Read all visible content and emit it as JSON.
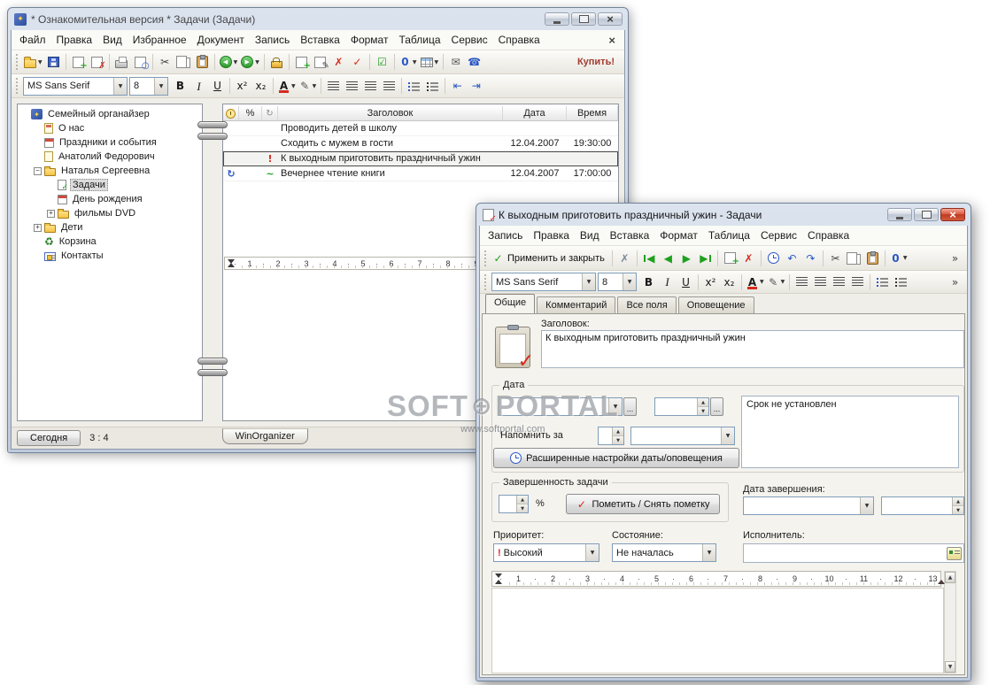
{
  "colors": {
    "accent_green": "#1fa11f",
    "accent_red": "#d42a1e",
    "accent_blue": "#2a57c6",
    "buy_link": "#a23c2f"
  },
  "watermark": {
    "left": "SOFT",
    "globe": "⊕",
    "right": "PORTAL",
    "url": "www.softportal.com"
  },
  "main_window": {
    "title": "* Ознакомительная версия * Задачи (Задачи)",
    "menu": [
      "Файл",
      "Правка",
      "Вид",
      "Избранное",
      "Документ",
      "Запись",
      "Вставка",
      "Формат",
      "Таблица",
      "Сервис",
      "Справка"
    ],
    "buy_label": "Купить!",
    "toolbar_icons": [
      {
        "name": "open-file",
        "shape": "folder",
        "dropdown": true
      },
      {
        "name": "save",
        "shape": "disk"
      },
      {
        "sep": true
      },
      {
        "name": "new-note",
        "shape": "page",
        "glyph": "+",
        "color": "#1fa11f"
      },
      {
        "name": "delete-note",
        "shape": "page",
        "glyph": "✗",
        "color": "#d42a1e"
      },
      {
        "sep": true
      },
      {
        "name": "print",
        "shape": "printer"
      },
      {
        "name": "print-preview",
        "shape": "page",
        "glyph": "○",
        "color": "#2a57c6"
      },
      {
        "sep": true
      },
      {
        "name": "cut",
        "glyph": "✂",
        "color": "#444444"
      },
      {
        "name": "copy",
        "shape": "pages"
      },
      {
        "name": "paste",
        "shape": "clip"
      },
      {
        "sep": true
      },
      {
        "name": "nav-back",
        "shape": "circle",
        "glyph": "◀",
        "dropdown": true
      },
      {
        "name": "nav-forward",
        "shape": "circle",
        "glyph": "▶",
        "dropdown": true
      },
      {
        "sep": true
      },
      {
        "name": "protect",
        "shape": "lock"
      },
      {
        "sep": true
      },
      {
        "name": "add-record",
        "shape": "page",
        "glyph": "+",
        "color": "#1fa11f"
      },
      {
        "name": "edit-record",
        "shape": "page",
        "glyph": "✎",
        "color": "#555555"
      },
      {
        "name": "delete-record",
        "glyph": "✗",
        "color": "#d42a1e"
      },
      {
        "name": "mark-record",
        "glyph": "✓",
        "color": "#d42a1e"
      },
      {
        "sep": true
      },
      {
        "name": "checkbox-field",
        "glyph": "☑",
        "color": "#1fa11f"
      },
      {
        "sep": true
      },
      {
        "name": "attachments",
        "glyph": "0",
        "color": "#2a57c6",
        "cls": "tb-bold",
        "dropdown": true
      },
      {
        "name": "insert-table",
        "shape": "grid",
        "dropdown": true
      },
      {
        "sep": true
      },
      {
        "name": "send-mail",
        "glyph": "✉",
        "color": "#555555"
      },
      {
        "name": "contact-call",
        "glyph": "☎",
        "color": "#2a57c6"
      }
    ],
    "format_bar": {
      "font": "MS Sans Serif",
      "size": "8"
    },
    "format_icons": [
      {
        "name": "bold",
        "glyph": "B",
        "cls": "tb-bold"
      },
      {
        "name": "italic",
        "glyph": "I",
        "cls": "tb-italic"
      },
      {
        "name": "underline",
        "glyph": "U",
        "cls": "tb-under"
      },
      {
        "sep": true
      },
      {
        "name": "superscript",
        "glyph": "x²"
      },
      {
        "name": "subscript",
        "glyph": "x₂"
      },
      {
        "sep": true
      },
      {
        "name": "font-color",
        "glyph": "A",
        "cls": "tb-bold a-color",
        "dropdown": true
      },
      {
        "name": "highlight",
        "glyph": "✎",
        "color": "#555555",
        "dropdown": true
      },
      {
        "sep": true
      },
      {
        "name": "align-left",
        "shape": "align"
      },
      {
        "name": "align-center",
        "shape": "align"
      },
      {
        "name": "align-right",
        "shape": "align"
      },
      {
        "name": "align-justify",
        "shape": "align"
      },
      {
        "sep": true
      },
      {
        "name": "bullet-list",
        "shape": "bullets"
      },
      {
        "name": "numbered-list",
        "shape": "bullets",
        "cls2": "num"
      },
      {
        "sep": true
      },
      {
        "name": "decrease-indent",
        "glyph": "⇤",
        "color": "#2a57c6"
      },
      {
        "name": "increase-indent",
        "glyph": "⇥",
        "color": "#2a57c6"
      }
    ],
    "tree": {
      "items": [
        {
          "label": "Семейный органайзер",
          "level": 0,
          "icon": "org",
          "expander": null
        },
        {
          "label": "О нас",
          "level": 1,
          "icon": "note-red",
          "expander": null
        },
        {
          "label": "Праздники и события",
          "level": 1,
          "icon": "cal",
          "expander": null
        },
        {
          "label": "Анатолий Федорович",
          "level": 1,
          "icon": "note",
          "expander": null
        },
        {
          "label": "Наталья Сергеевна",
          "level": 1,
          "icon": "folder",
          "expander": "minus"
        },
        {
          "label": "Задачи",
          "level": 2,
          "icon": "check",
          "expander": null,
          "selected": true
        },
        {
          "label": "День рождения",
          "level": 2,
          "icon": "cal",
          "expander": null
        },
        {
          "label": "фильмы DVD",
          "level": 2,
          "icon": "folder",
          "expander": "plus"
        },
        {
          "label": "Дети",
          "level": 1,
          "icon": "folder",
          "expander": "plus"
        },
        {
          "label": "Корзина",
          "level": 1,
          "icon": "recycle",
          "expander": null
        },
        {
          "label": "Контакты",
          "level": 1,
          "icon": "contacts",
          "expander": null
        }
      ]
    },
    "task_table": {
      "columns": [
        {
          "icon": "alarm"
        },
        {
          "label": "%"
        },
        {
          "icon": "recur"
        },
        {
          "label": "Заголовок"
        },
        {
          "label": "Дата"
        },
        {
          "label": "Время"
        }
      ],
      "rows": [
        {
          "title": "Проводить детей в школу",
          "date": "",
          "time": ""
        },
        {
          "title": "Сходить с мужем в гости",
          "date": "12.04.2007",
          "time": "19:30:00"
        },
        {
          "title": "К выходным приготовить праздничный ужин",
          "date": "",
          "time": "",
          "flag": "priority",
          "selected": true
        },
        {
          "title": "Вечернее чтение книги",
          "date": "12.04.2007",
          "time": "17:00:00",
          "alarm": "recur",
          "flag": "tilde"
        }
      ]
    },
    "ruler_numbers": [
      "1",
      "2",
      "3",
      "4",
      "5",
      "6",
      "7",
      "8",
      "9"
    ],
    "status": {
      "today_button": "Сегодня",
      "counter": "3 : 4",
      "notebook_tab": "WinOrganizer"
    }
  },
  "dialog": {
    "title": "К выходным приготовить праздничный ужин - Задачи",
    "menu": [
      "Запись",
      "Правка",
      "Вид",
      "Вставка",
      "Формат",
      "Таблица",
      "Сервис",
      "Справка"
    ],
    "toolbar_icons": [
      {
        "name": "apply-and-close",
        "glyph": "✓",
        "color": "#1fa11f",
        "cls": "tb-bold",
        "label": "Применить и закрыть"
      },
      {
        "sep": true
      },
      {
        "name": "cancel",
        "glyph": "✗",
        "color": "#7a8798"
      },
      {
        "sep": true
      },
      {
        "name": "first-record",
        "glyph": "◀",
        "color": "#1fa11f",
        "cls": "bar-l"
      },
      {
        "name": "prev-record",
        "glyph": "◀",
        "color": "#1fa11f"
      },
      {
        "name": "next-record",
        "glyph": "▶",
        "color": "#1fa11f"
      },
      {
        "name": "last-record",
        "glyph": "▶",
        "color": "#1fa11f",
        "cls": "bar-r"
      },
      {
        "sep": true
      },
      {
        "name": "add-record",
        "shape": "page",
        "glyph": "+",
        "color": "#1fa11f"
      },
      {
        "name": "delete-record",
        "glyph": "✗",
        "color": "#d42a1e"
      },
      {
        "sep": true
      },
      {
        "name": "alarm",
        "shape": "clock"
      },
      {
        "name": "undo",
        "glyph": "↶",
        "color": "#2a57c6"
      },
      {
        "name": "redo",
        "glyph": "↷",
        "color": "#2a57c6"
      },
      {
        "sep": true
      },
      {
        "name": "cut",
        "glyph": "✂",
        "color": "#444444"
      },
      {
        "name": "copy",
        "shape": "pages"
      },
      {
        "name": "paste",
        "shape": "clip"
      },
      {
        "sep": true
      },
      {
        "name": "attachments",
        "glyph": "0",
        "color": "#2a57c6",
        "cls": "tb-bold",
        "dropdown": true
      },
      {
        "name": "toolbar-overflow",
        "glyph": "»",
        "color": "#444444",
        "right": true
      }
    ],
    "format_bar": {
      "font": "MS Sans Serif",
      "size": "8"
    },
    "format_icons": [
      {
        "name": "bold",
        "glyph": "B",
        "cls": "tb-bold"
      },
      {
        "name": "italic",
        "glyph": "I",
        "cls": "tb-italic"
      },
      {
        "name": "underline",
        "glyph": "U",
        "cls": "tb-under"
      },
      {
        "sep": true
      },
      {
        "name": "superscript",
        "glyph": "x²"
      },
      {
        "name": "subscript",
        "glyph": "x₂"
      },
      {
        "sep": true
      },
      {
        "name": "font-color",
        "glyph": "A",
        "cls": "tb-bold a-color",
        "dropdown": true
      },
      {
        "name": "highlight",
        "glyph": "✎",
        "color": "#555555",
        "dropdown": true
      },
      {
        "sep": true
      },
      {
        "name": "align-left",
        "shape": "align"
      },
      {
        "name": "align-center",
        "shape": "align"
      },
      {
        "name": "align-right",
        "shape": "align"
      },
      {
        "name": "align-justify",
        "shape": "align"
      },
      {
        "sep": true
      },
      {
        "name": "bullet-list",
        "shape": "bullets"
      },
      {
        "name": "numbered-list",
        "shape": "bullets",
        "cls2": "num"
      },
      {
        "name": "toolbar-overflow",
        "glyph": "»",
        "color": "#444444",
        "right": true
      }
    ],
    "tabs": [
      "Общие",
      "Комментарий",
      "Все поля",
      "Оповещение"
    ],
    "fields": {
      "title_label": "Заголовок:",
      "title_value": "К выходным приготовить праздничный ужин",
      "date_group": "Дата",
      "no_due_text": "Срок не установлен",
      "remind_label": "Напомнить за",
      "advanced_button": "Расширенные настройки даты/оповещения",
      "completion_group": "Завершенность задачи",
      "percent_sign": "%",
      "mark_button": "Пометить / Снять пометку",
      "completion_date_label": "Дата завершения:",
      "priority_label": "Приоритет:",
      "priority_value": "Высокий",
      "state_label": "Состояние:",
      "state_value": "Не началась",
      "executor_label": "Исполнитель:"
    },
    "ruler_numbers": [
      "1",
      "2",
      "3",
      "4",
      "5",
      "6",
      "7",
      "8",
      "9",
      "10",
      "11",
      "12",
      "13"
    ]
  }
}
